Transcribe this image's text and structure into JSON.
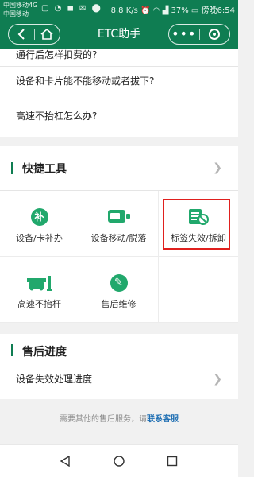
{
  "status_bar": {
    "carrier1": "中国移动4G",
    "carrier2": "中国移动",
    "speed": "8.8 K/s",
    "battery": "37%",
    "clock": "傍晚6:54"
  },
  "nav": {
    "title": "ETC助手"
  },
  "faq": {
    "items": [
      {
        "label": "通行后怎样扣费的?"
      },
      {
        "label": "设备和卡片能不能移动或者拔下?"
      },
      {
        "label": "高速不抬杠怎么办?"
      }
    ]
  },
  "tools": {
    "title": "快捷工具",
    "items": [
      {
        "label": "设备/卡补办",
        "icon": "card-reissue-icon",
        "glyph": "补"
      },
      {
        "label": "设备移动/脱落",
        "icon": "device-icon"
      },
      {
        "label": "标签失效/拆卸",
        "icon": "tag-invalid-icon"
      },
      {
        "label": "高速不抬杆",
        "icon": "barrier-gate-icon"
      },
      {
        "label": "售后维修",
        "icon": "wrench-icon"
      }
    ],
    "highlighted_item": "标签失效/拆卸",
    "accent_color": "#21a86c",
    "highlight_color": "#e0201e"
  },
  "progress": {
    "title": "售后进度",
    "row_label": "设备失效处理进度"
  },
  "footer": {
    "prefix": "需要其他的售后服务，请",
    "link": "联系客服"
  }
}
